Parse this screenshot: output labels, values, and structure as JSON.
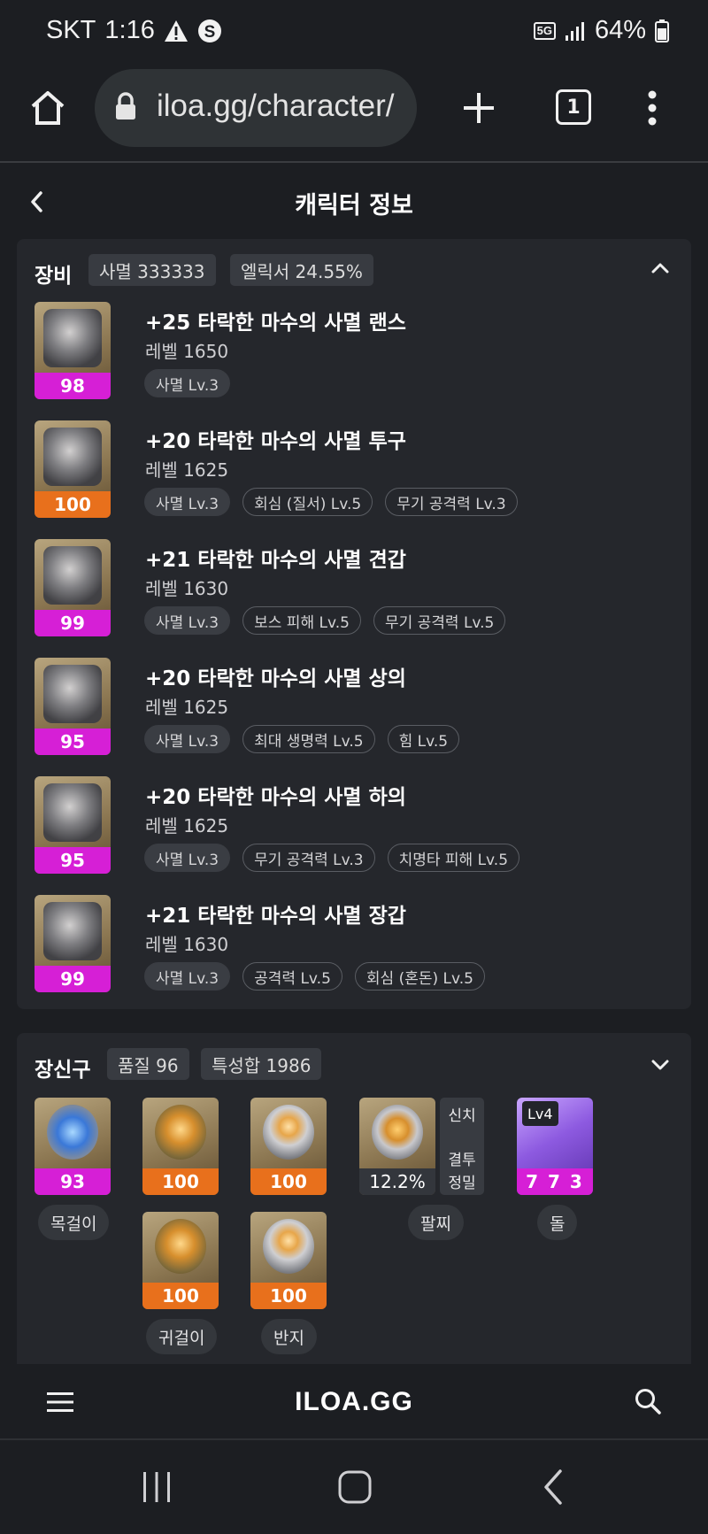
{
  "status_bar": {
    "carrier": "SKT",
    "time": "1:16",
    "network": "5G",
    "battery": "64%"
  },
  "browser": {
    "url": "iloa.gg/character/",
    "tab_count": "1"
  },
  "header": {
    "title": "캐릭터 정보"
  },
  "equipment": {
    "title": "장비",
    "badges": [
      "사멸 333333",
      "엘릭서 24.55%"
    ],
    "items": [
      {
        "name": "+25 타락한 마수의 사멸 랜스",
        "level": "레벨 1650",
        "quality": "98",
        "quality_color": "#d61fd6",
        "tags": [
          "사멸 Lv.3"
        ]
      },
      {
        "name": "+20 타락한 마수의 사멸 투구",
        "level": "레벨 1625",
        "quality": "100",
        "quality_color": "#e8701c",
        "tags": [
          "사멸 Lv.3",
          "회심 (질서) Lv.5",
          "무기 공격력 Lv.3"
        ]
      },
      {
        "name": "+21 타락한 마수의 사멸 견갑",
        "level": "레벨 1630",
        "quality": "99",
        "quality_color": "#d61fd6",
        "tags": [
          "사멸 Lv.3",
          "보스 피해 Lv.5",
          "무기 공격력 Lv.5"
        ]
      },
      {
        "name": "+20 타락한 마수의 사멸 상의",
        "level": "레벨 1625",
        "quality": "95",
        "quality_color": "#d61fd6",
        "tags": [
          "사멸 Lv.3",
          "최대 생명력 Lv.5",
          "힘 Lv.5"
        ]
      },
      {
        "name": "+20 타락한 마수의 사멸 하의",
        "level": "레벨 1625",
        "quality": "95",
        "quality_color": "#d61fd6",
        "tags": [
          "사멸 Lv.3",
          "무기 공격력 Lv.3",
          "치명타 피해 Lv.5"
        ]
      },
      {
        "name": "+21 타락한 마수의 사멸 장갑",
        "level": "레벨 1630",
        "quality": "99",
        "quality_color": "#d61fd6",
        "tags": [
          "사멸 Lv.3",
          "공격력 Lv.5",
          "회심 (혼돈) Lv.5"
        ]
      }
    ]
  },
  "accessories": {
    "title": "장신구",
    "badges": [
      "품질 96",
      "특성합 1986"
    ],
    "necklace": {
      "quality": "93",
      "label": "목걸이"
    },
    "earrings": {
      "quality": [
        "100",
        "100"
      ],
      "label": "귀걸이"
    },
    "rings": {
      "quality": [
        "100",
        "100"
      ],
      "label": "반지"
    },
    "bracelet": {
      "value": "12.2%",
      "label": "팔찌",
      "effects": [
        "신치",
        "결투",
        "정밀"
      ]
    },
    "stone": {
      "level": "Lv4",
      "value": "7 7 3",
      "label": "돌"
    }
  },
  "bottom_bar": {
    "logo": "ILOA.GG"
  }
}
